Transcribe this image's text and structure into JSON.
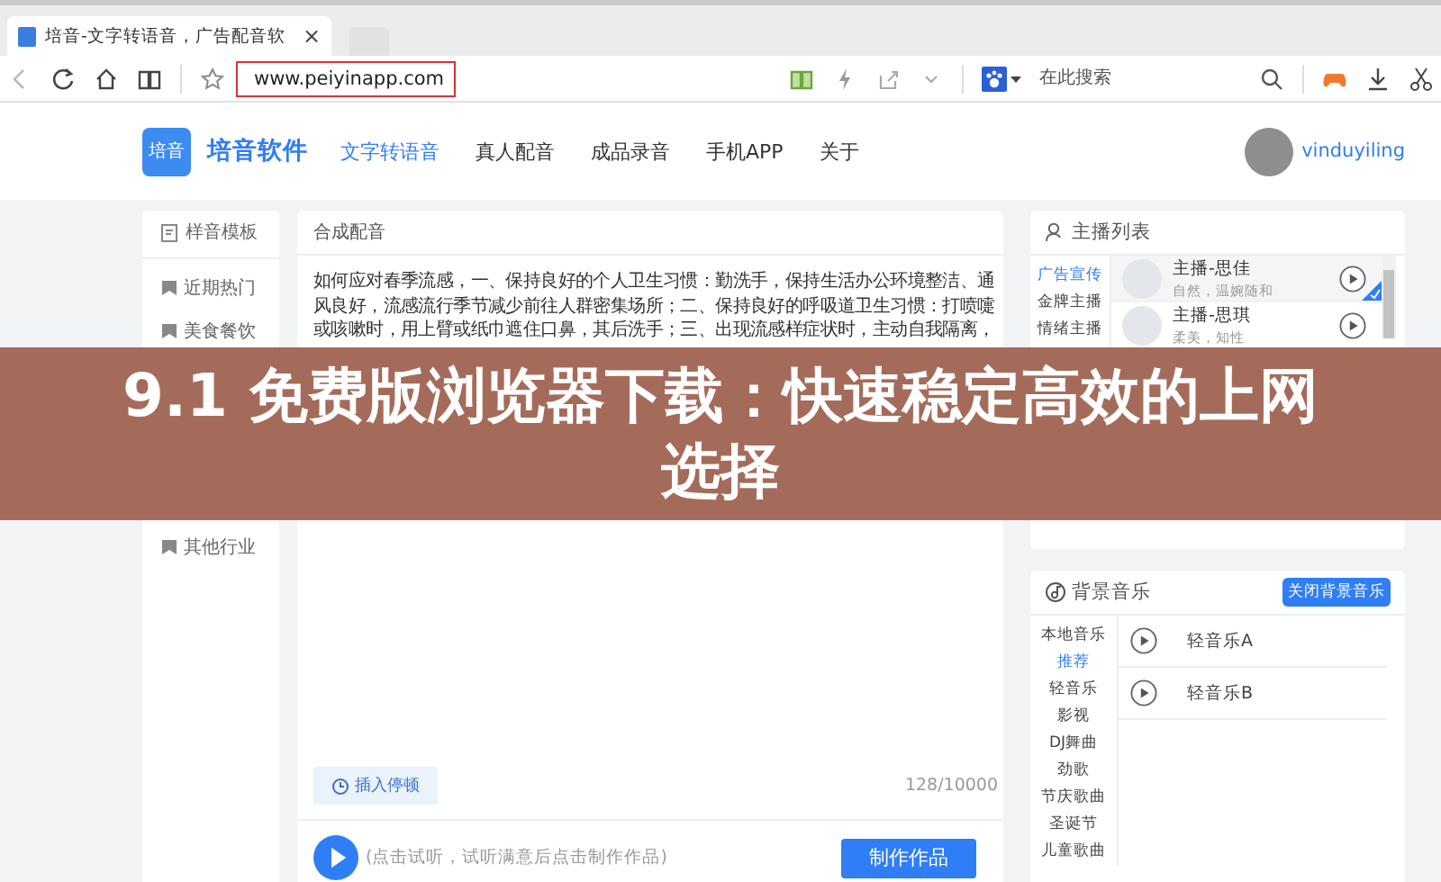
{
  "browser": {
    "tab_title": "培音-文字转语音，广告配音软",
    "tab_close": "×",
    "address": "www.peiyinapp.com",
    "search_placeholder": "在此搜索"
  },
  "site": {
    "logo_text": "培音",
    "brand": "培音软件",
    "username": "vinduyiling",
    "nav": [
      {
        "label": "文字转语音",
        "selected": true
      },
      {
        "label": "真人配音",
        "selected": false
      },
      {
        "label": "成品录音",
        "selected": false
      },
      {
        "label": "手机APP",
        "selected": false
      },
      {
        "label": "关于",
        "selected": false
      }
    ]
  },
  "templates": {
    "title": "样音模板",
    "items": [
      {
        "label": "近期热门"
      },
      {
        "label": "美食餐饮"
      }
    ],
    "items_below": [
      {
        "label": "其他行业"
      }
    ]
  },
  "editor": {
    "title": "合成配音",
    "text": "如何应对春季流感，一、保持良好的个人卫生习惯：勤洗手，保持生活办公环境整洁、通风良好，流感流行季节减少前往人群密集场所；二、保持良好的呼吸道卫生习惯：打喷嚏或咳嗽时，用上臂或纸巾遮住口鼻，其后洗手；三、出现流感样症状时，主动自我隔离，",
    "insert_pause": "插入停顿",
    "char_count": "128/10000",
    "preview_hint": "(点击试听，试听满意后点击制作作品)",
    "make_button": "制作作品"
  },
  "voices": {
    "title": "主播列表",
    "categories": [
      {
        "label": "广告宣传",
        "selected": true
      },
      {
        "label": "金牌主播",
        "selected": false
      },
      {
        "label": "情绪主播",
        "selected": false
      }
    ],
    "items": [
      {
        "name": "主播-思佳",
        "style": "自然，温婉随和",
        "selected": true
      },
      {
        "name": "主播-思琪",
        "style": "柔美，知性",
        "selected": false
      }
    ]
  },
  "music": {
    "title": "背景音乐",
    "close_button": "关闭背景音乐",
    "categories": [
      {
        "label": "本地音乐",
        "selected": false
      },
      {
        "label": "推荐",
        "selected": true
      },
      {
        "label": "轻音乐",
        "selected": false
      },
      {
        "label": "影视",
        "selected": false
      },
      {
        "label": "DJ舞曲",
        "selected": false
      },
      {
        "label": "劲歌",
        "selected": false
      },
      {
        "label": "节庆歌曲",
        "selected": false
      },
      {
        "label": "圣诞节",
        "selected": false
      },
      {
        "label": "儿童歌曲",
        "selected": false
      }
    ],
    "tracks": [
      {
        "name": "轻音乐A"
      },
      {
        "name": "轻音乐B"
      }
    ]
  },
  "banner": {
    "title": "9.1 免费版浏览器下载：快速稳定高效的上网选择"
  }
}
